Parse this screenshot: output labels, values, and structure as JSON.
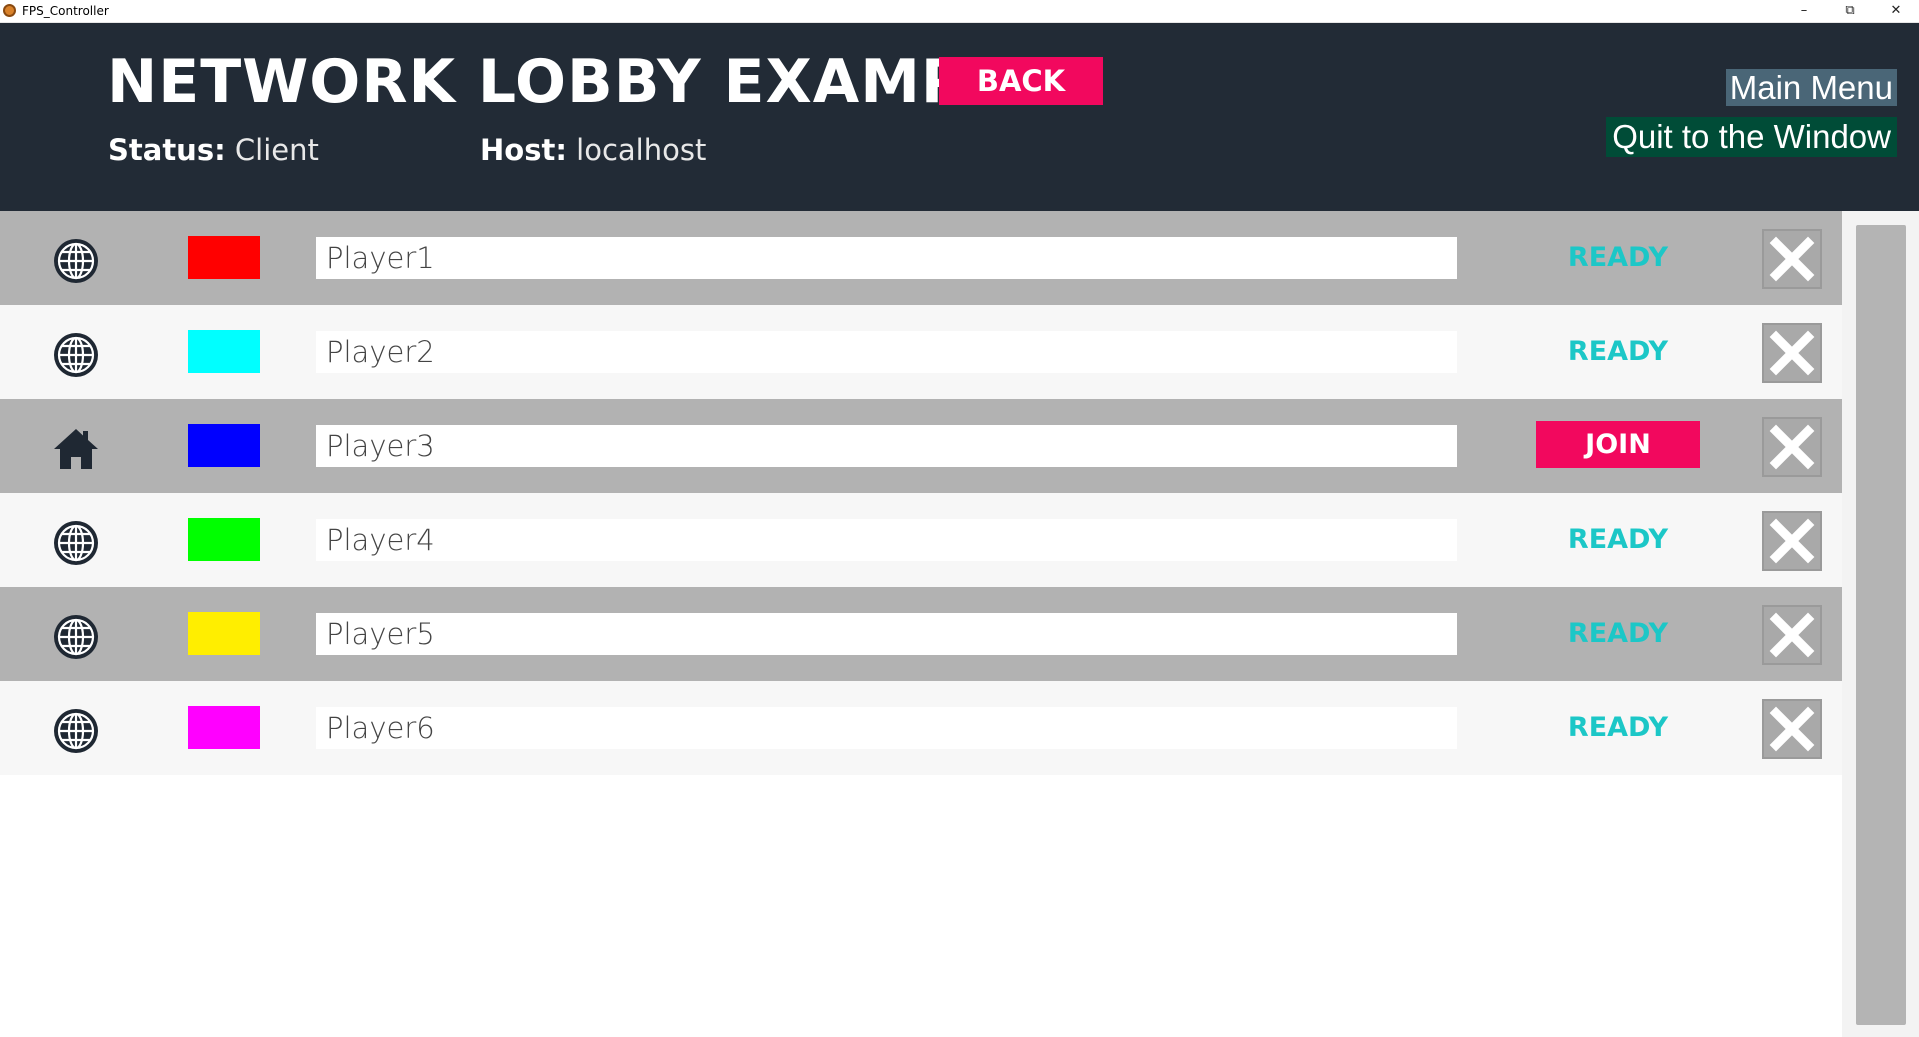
{
  "window": {
    "title": "FPS_Controller",
    "minimize_glyph": "–",
    "restore_glyph": "⧉",
    "close_glyph": "✕"
  },
  "header": {
    "title": "NETWORK LOBBY EXAMPLE",
    "back_label": "BACK",
    "status_label": "Status:",
    "status_value": "Client",
    "host_label": "Host:",
    "host_value": "localhost",
    "main_menu_label": "Main Menu",
    "quit_label": "Quit to the Window"
  },
  "colors": {
    "accent_pink": "#f2085e",
    "ready_cyan": "#1cc7c7",
    "header_bg": "#222b36"
  },
  "players": [
    {
      "name": "Player1",
      "color": "#ff0000",
      "icon": "globe-icon",
      "state": "READY",
      "row_style": "dark"
    },
    {
      "name": "Player2",
      "color": "#00ffff",
      "icon": "globe-icon",
      "state": "READY",
      "row_style": "light"
    },
    {
      "name": "Player3",
      "color": "#0000ff",
      "icon": "home-icon",
      "state": "JOIN",
      "row_style": "dark"
    },
    {
      "name": "Player4",
      "color": "#00ff00",
      "icon": "globe-icon",
      "state": "READY",
      "row_style": "light"
    },
    {
      "name": "Player5",
      "color": "#ffee00",
      "icon": "globe-icon",
      "state": "READY",
      "row_style": "dark"
    },
    {
      "name": "Player6",
      "color": "#ff00ff",
      "icon": "globe-icon",
      "state": "READY",
      "row_style": "light"
    }
  ]
}
